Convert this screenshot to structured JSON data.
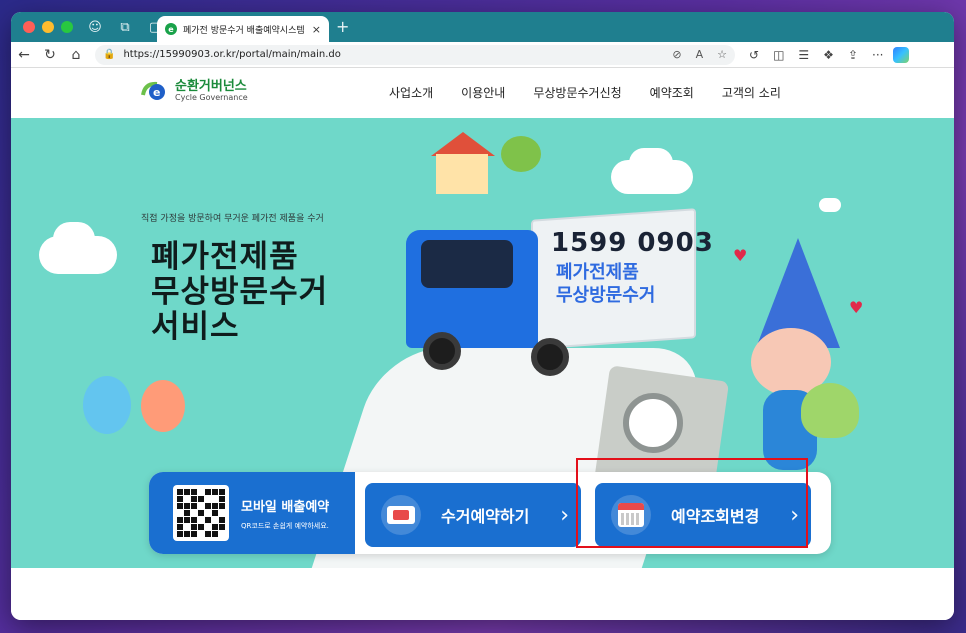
{
  "browser": {
    "tab_title": "폐가전 방문수거 배출예약시스템",
    "tab_close": "×",
    "new_tab": "+",
    "url": "https://15990903.or.kr/portal/main/main.do",
    "nav": {
      "back": "←",
      "reload": "↻",
      "home": "⌂"
    },
    "toolbar_more": "···"
  },
  "site": {
    "logo_ko": "순환거버넌스",
    "logo_en": "Cycle Governance",
    "menu": [
      "사업소개",
      "이용안내",
      "무상방문수거신청",
      "예약조회",
      "고객의 소리"
    ]
  },
  "hero": {
    "subtitle": "직접 가정을 방문하여 무거운 폐가전 제품을 수거",
    "title_lines": [
      "폐가전제품",
      "무상방문수거",
      "서비스"
    ],
    "truck_phone": "1599 0903",
    "truck_line1": "폐가전제품",
    "truck_line2": "무상방문수거"
  },
  "quick": {
    "mobile_title": "모바일 배출예약",
    "mobile_sub": "QR코드로 손쉽게 예약하세요.",
    "reserve_label": "수거예약하기",
    "check_label": "예약조회변경",
    "arrow": "›"
  },
  "colors": {
    "tab_bar": "#1f7f8f",
    "hero_bg": "#6fd8c9",
    "brand_blue": "#1a6fd0",
    "highlight": "#e3101a"
  }
}
